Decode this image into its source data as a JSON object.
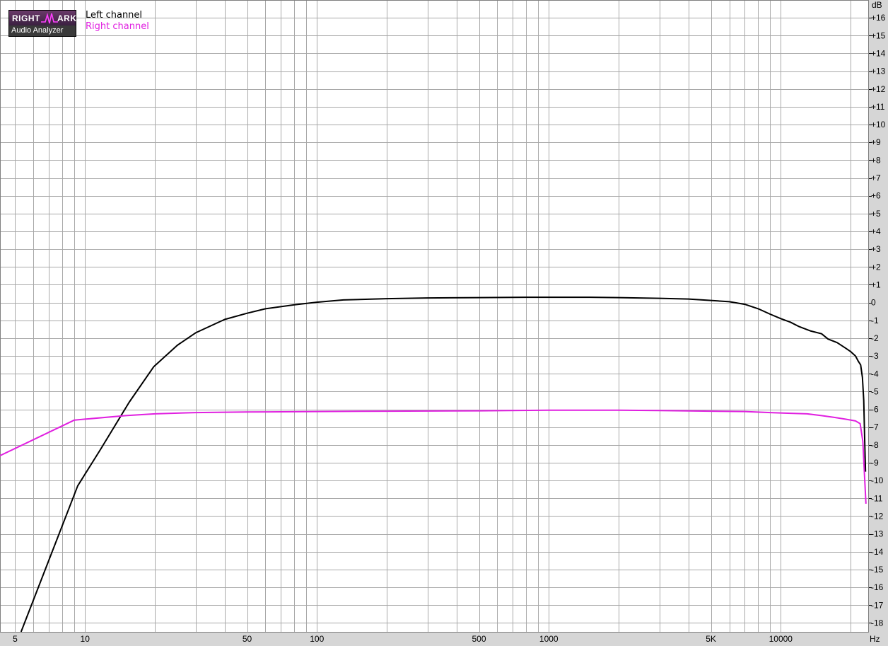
{
  "logo": {
    "top_left": "RIGHT",
    "top_right": "ARK",
    "bottom": "Audio Analyzer"
  },
  "legend": {
    "left_label": "Left channel",
    "left_color": "#000000",
    "right_label": "Right channel",
    "right_color": "#e020e0"
  },
  "chart_data": {
    "type": "line",
    "xscale": "log",
    "x_unit_label": "Hz",
    "y_unit_label": "dB",
    "xlim": [
      4.3,
      24000
    ],
    "ylim": [
      -18.5,
      17
    ],
    "grid": true,
    "x_ticks": [
      {
        "value": 5,
        "label": "5"
      },
      {
        "value": 10,
        "label": "10"
      },
      {
        "value": 50,
        "label": "50"
      },
      {
        "value": 100,
        "label": "100"
      },
      {
        "value": 500,
        "label": "500"
      },
      {
        "value": 1000,
        "label": "1000"
      },
      {
        "value": 5000,
        "label": "5K"
      },
      {
        "value": 10000,
        "label": "10000"
      }
    ],
    "y_ticks": [
      16,
      15,
      14,
      13,
      12,
      11,
      10,
      9,
      8,
      7,
      6,
      5,
      4,
      3,
      2,
      1,
      0,
      -1,
      -2,
      -3,
      -4,
      -5,
      -6,
      -7,
      -8,
      -9,
      -10,
      -11,
      -12,
      -13,
      -14,
      -15,
      -16,
      -17,
      -18
    ],
    "y_tick_labels": [
      "+16",
      "+15",
      "+14",
      "+13",
      "+12",
      "+11",
      "+10",
      "+9",
      "+8",
      "+7",
      "+6",
      "+5",
      "+4",
      "+3",
      "+2",
      "+1",
      "0",
      "-1",
      "-2",
      "-3",
      "-4",
      "-5",
      "-6",
      "-7",
      "-8",
      "-9",
      "-10",
      "-11",
      "-12",
      "-13",
      "-14",
      "-15",
      "-16",
      "-17",
      "-18"
    ],
    "series": [
      {
        "name": "Left channel",
        "color": "#000000",
        "points": [
          [
            5.3,
            -18.5
          ],
          [
            9.3,
            -10.3
          ],
          [
            11.6,
            -8.3
          ],
          [
            15.5,
            -5.6
          ],
          [
            19.8,
            -3.6
          ],
          [
            25,
            -2.4
          ],
          [
            30,
            -1.7
          ],
          [
            40,
            -0.95
          ],
          [
            50,
            -0.6
          ],
          [
            60,
            -0.35
          ],
          [
            80,
            -0.12
          ],
          [
            100,
            0.02
          ],
          [
            130,
            0.15
          ],
          [
            200,
            0.22
          ],
          [
            300,
            0.26
          ],
          [
            500,
            0.28
          ],
          [
            800,
            0.3
          ],
          [
            1000,
            0.3
          ],
          [
            1500,
            0.3
          ],
          [
            2000,
            0.28
          ],
          [
            3000,
            0.24
          ],
          [
            4000,
            0.2
          ],
          [
            5000,
            0.12
          ],
          [
            6000,
            0.05
          ],
          [
            7000,
            -0.1
          ],
          [
            8000,
            -0.35
          ],
          [
            9000,
            -0.65
          ],
          [
            10000,
            -0.9
          ],
          [
            11000,
            -1.1
          ],
          [
            12000,
            -1.35
          ],
          [
            13500,
            -1.6
          ],
          [
            15000,
            -1.75
          ],
          [
            16000,
            -2.05
          ],
          [
            17500,
            -2.25
          ],
          [
            19000,
            -2.55
          ],
          [
            20000,
            -2.75
          ],
          [
            21000,
            -3.0
          ],
          [
            21600,
            -3.3
          ],
          [
            22100,
            -3.5
          ],
          [
            22500,
            -4.2
          ],
          [
            22800,
            -5.5
          ],
          [
            23000,
            -7.5
          ],
          [
            23200,
            -9.5
          ]
        ]
      },
      {
        "name": "Right channel",
        "color": "#e020e0",
        "points": [
          [
            4.3,
            -8.6
          ],
          [
            9,
            -6.6
          ],
          [
            10,
            -6.55
          ],
          [
            15,
            -6.35
          ],
          [
            20,
            -6.25
          ],
          [
            30,
            -6.18
          ],
          [
            50,
            -6.15
          ],
          [
            100,
            -6.12
          ],
          [
            200,
            -6.1
          ],
          [
            500,
            -6.08
          ],
          [
            1000,
            -6.05
          ],
          [
            2000,
            -6.05
          ],
          [
            3000,
            -6.07
          ],
          [
            5000,
            -6.1
          ],
          [
            7000,
            -6.12
          ],
          [
            9000,
            -6.18
          ],
          [
            11000,
            -6.22
          ],
          [
            13000,
            -6.25
          ],
          [
            15000,
            -6.35
          ],
          [
            17000,
            -6.45
          ],
          [
            19000,
            -6.55
          ],
          [
            21000,
            -6.65
          ],
          [
            22000,
            -6.8
          ],
          [
            22600,
            -7.8
          ],
          [
            23000,
            -9.8
          ],
          [
            23300,
            -11.3
          ]
        ]
      }
    ]
  }
}
